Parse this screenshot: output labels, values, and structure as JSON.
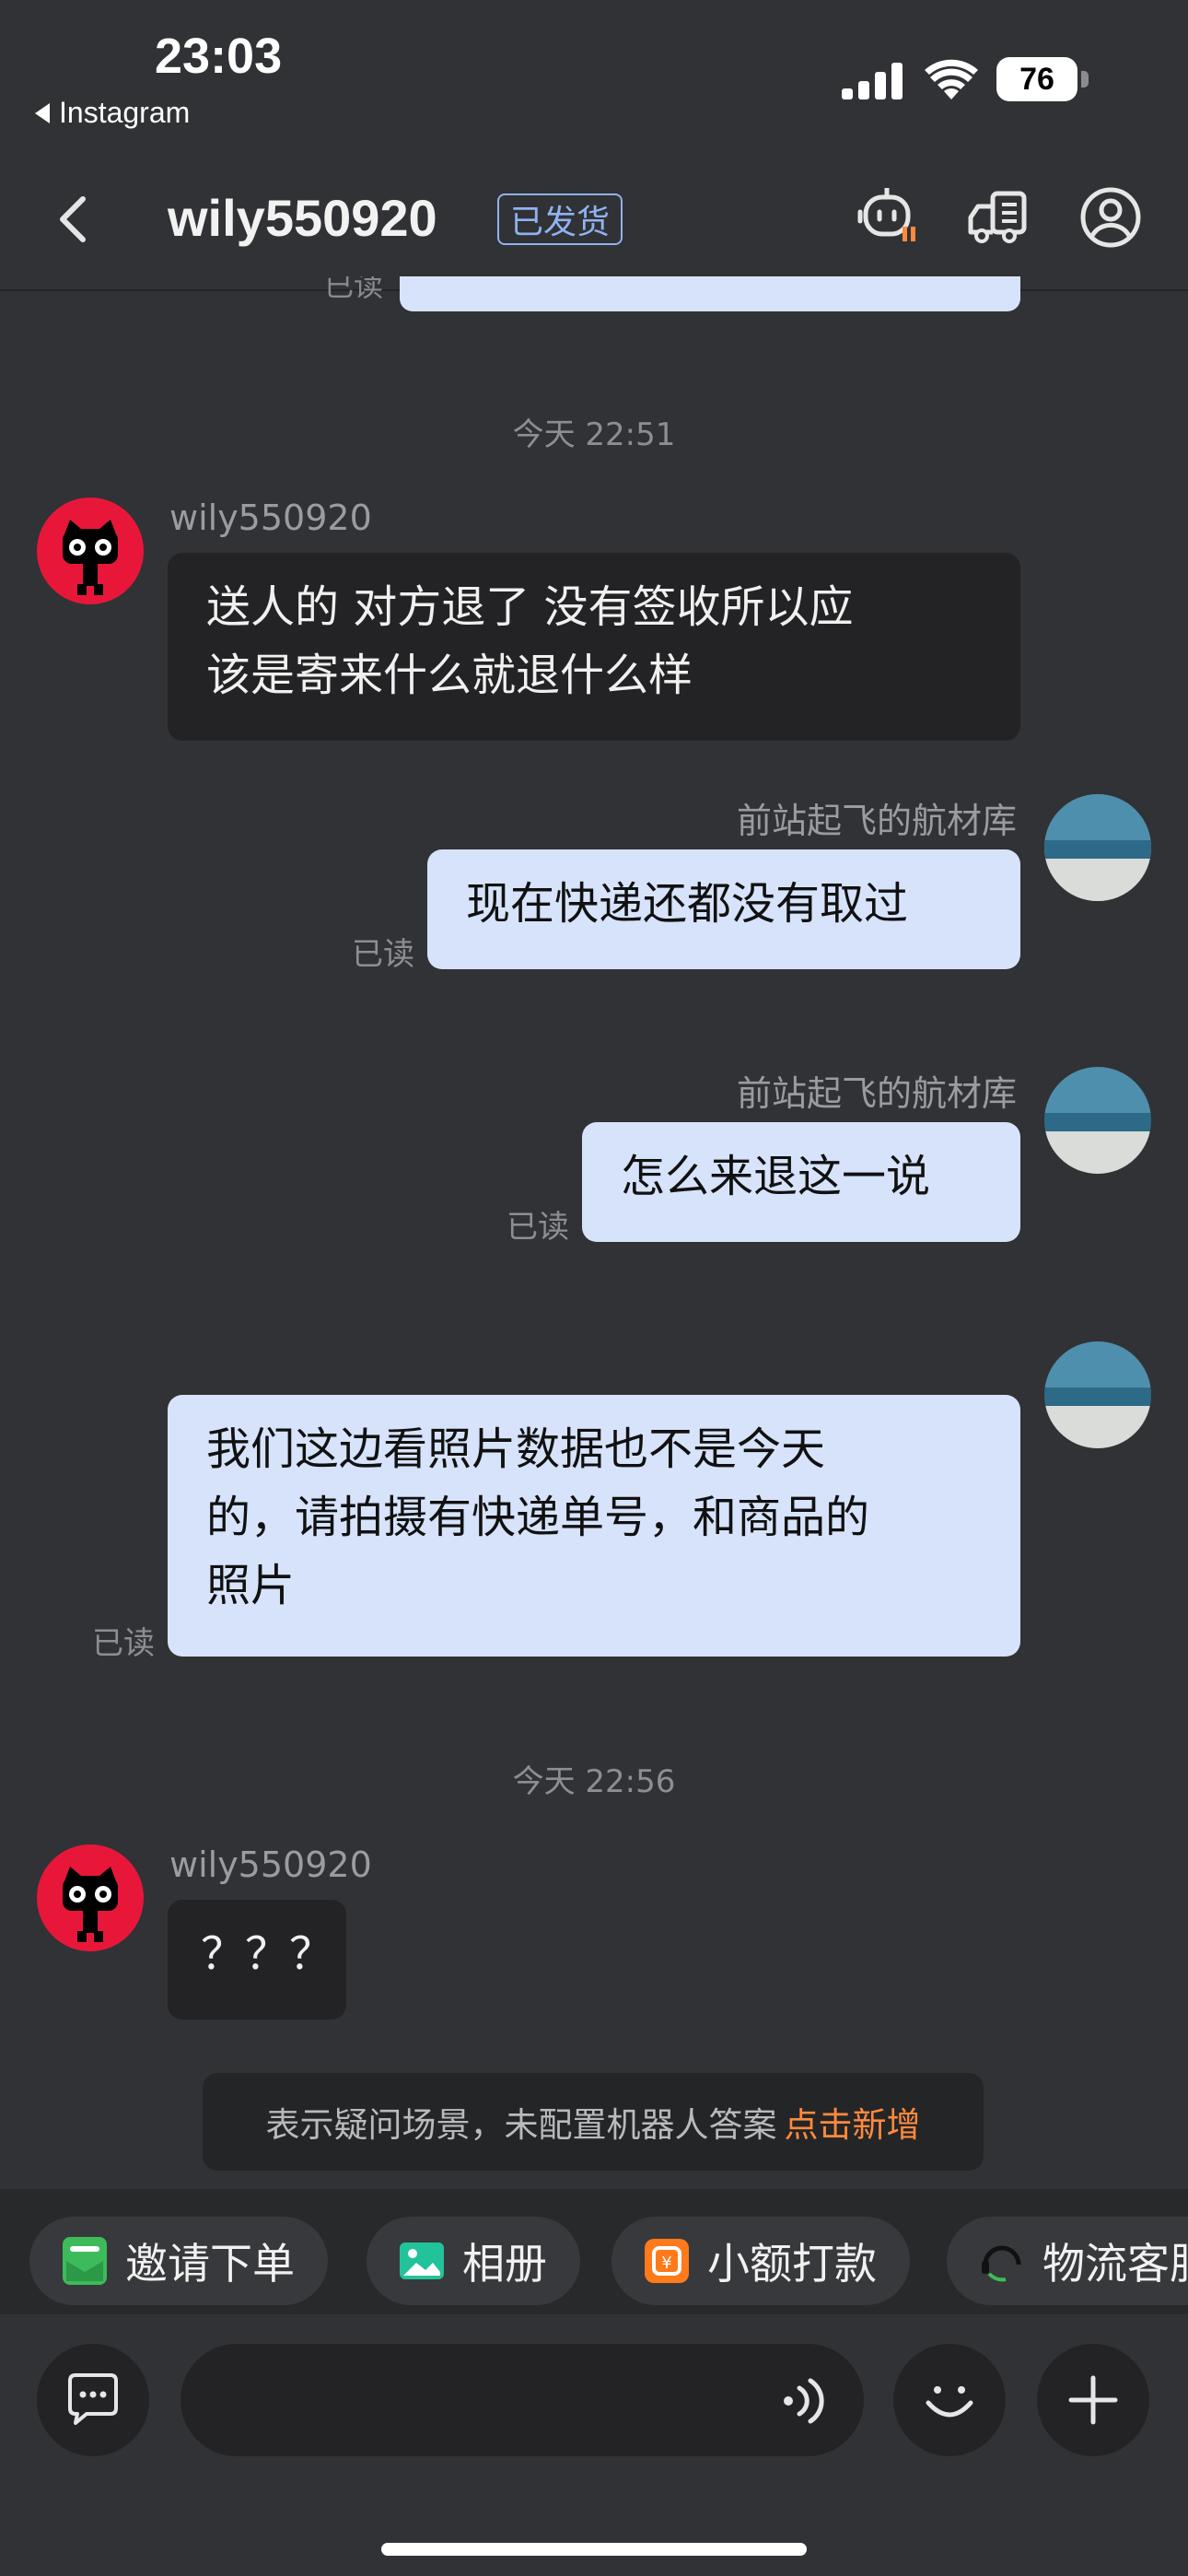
{
  "status_bar": {
    "time": "23:03",
    "back_app": "Instagram",
    "battery": "76"
  },
  "header": {
    "title": "wily550920",
    "tag": "已发货",
    "icons": [
      "robot-icon",
      "delivery-truck-icon",
      "profile-icon"
    ]
  },
  "messages": {
    "top_partial_read": "已读",
    "ts1": "今天 22:51",
    "m1": {
      "sender": "wily550920",
      "text_l1": "送人的 对方退了 没有签收所以应",
      "text_l2": "该是寄来什么就退什么样"
    },
    "m2": {
      "sender": "前站起飞的航材库",
      "text": "现在快递还都没有取过",
      "read": "已读"
    },
    "m3": {
      "sender": "前站起飞的航材库",
      "text": "怎么来退这一说",
      "read": "已读"
    },
    "m4": {
      "text_l1": "我们这边看照片数据也不是今天",
      "text_l2": "的，请拍摄有快递单号，和商品的",
      "text_l3": "照片",
      "read": "已读"
    },
    "ts2": "今天 22:56",
    "m5": {
      "sender": "wily550920",
      "text": "？？？"
    }
  },
  "notice": {
    "text": "表示疑问场景，未配置机器人答案",
    "link": "点击新增"
  },
  "quick_actions": [
    {
      "label": "邀请下单",
      "icon": "invite-order-icon",
      "color": "#3dbb5a"
    },
    {
      "label": "相册",
      "icon": "album-icon",
      "color": "#22c39a"
    },
    {
      "label": "小额打款",
      "icon": "payment-icon",
      "color": "#ff7a1a"
    },
    {
      "label": "物流客服",
      "icon": "logistics-service-icon",
      "color": "#222222"
    }
  ],
  "input": {
    "icons": [
      "chat-bubble-icon",
      "voice-icon",
      "emoji-icon",
      "plus-icon"
    ]
  },
  "colors": {
    "background": "#313235",
    "incoming_bubble": "#232325",
    "outgoing_bubble": "#d6e3fb",
    "accent_link": "#ff8a3d",
    "tag_blue": "#8fb2f2"
  }
}
